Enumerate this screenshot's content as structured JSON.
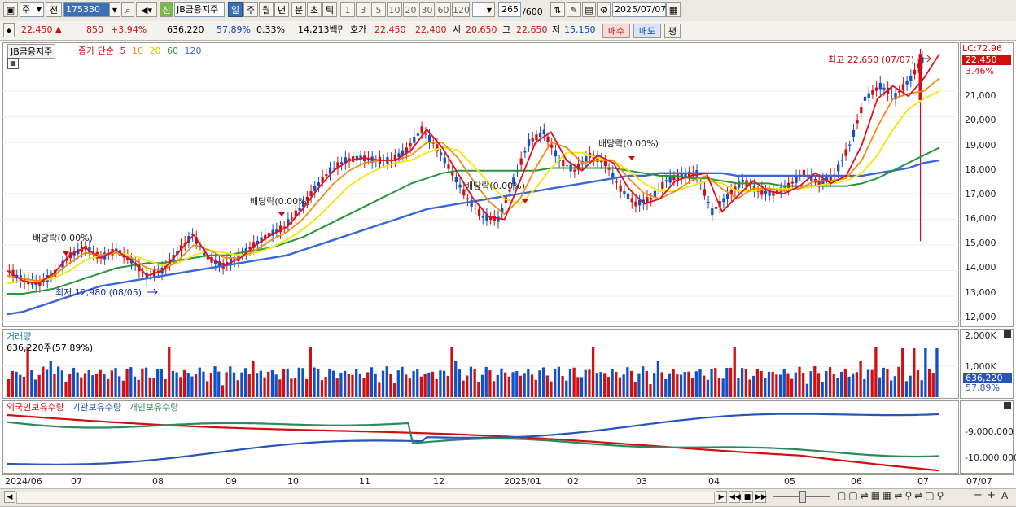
{
  "toolbar": {
    "type_select": "주",
    "prev_label": "전",
    "code": "175330",
    "credit_badge": "신",
    "stock_name": "JB금융지주",
    "period_tabs": [
      "일",
      "주",
      "월",
      "년",
      "분",
      "초",
      "틱"
    ],
    "active_period": "일",
    "interval_buttons": [
      "1",
      "3",
      "5",
      "10",
      "20",
      "30",
      "60",
      "120"
    ],
    "count_value": "265",
    "count_max": "/600",
    "date_value": "2025/07/07"
  },
  "quote": {
    "price": "22,450",
    "change": "850",
    "change_pct": "+3.94%",
    "volume": "636,220",
    "volume_ratio": "57.89%",
    "turnover": "0.33%",
    "amount": "14,213백만",
    "bid_label": "호가",
    "bid1": "22,450",
    "bid2": "22,400",
    "open_label": "시",
    "open": "20,650",
    "high_label": "고",
    "high": "22,650",
    "low_label": "저",
    "low": "15,150",
    "buy_label": "매수",
    "sell_label": "매도",
    "extra_label": "평"
  },
  "price_panel": {
    "name_box": "JB금융지주",
    "legend_text": "종가 단순",
    "ma_labels": [
      "5",
      "10",
      "20",
      "60",
      "120"
    ],
    "lc_label": "LC:72.96",
    "last_price": "22,450",
    "last_pct": "3.46%",
    "high_annotation": "최고 22,650 (07/07)",
    "low_annotation": "최저 12,980 (08/05)",
    "dividend_labels": [
      "배당락(0.00%)",
      "배당락(0.00%)",
      "배당락(0.00%)",
      "배당락(0.00%)"
    ],
    "y_ticks": [
      "21,000",
      "20,000",
      "19,000",
      "18,000",
      "17,000",
      "16,000",
      "15,000",
      "14,000",
      "13,000",
      "12,000"
    ]
  },
  "volume_panel": {
    "title": "거래량",
    "value_text": "636,220주(57.89%)",
    "y_ticks": [
      "2,000K",
      "1,000K"
    ],
    "last_value": "636,220",
    "last_pct": "57.89%"
  },
  "holdings_panel": {
    "legends": [
      "외국인보유수량",
      "기관보유수량",
      "개인보유수량"
    ],
    "y_ticks": [
      "-9,000,000",
      "-10,000,000"
    ]
  },
  "x_axis": [
    "2024/06",
    "07",
    "08",
    "09",
    "10",
    "11",
    "12",
    "2025/01",
    "02",
    "03",
    "04",
    "05",
    "06",
    "07",
    "07/07"
  ],
  "colors": {
    "up": "#d01010",
    "down": "#1050c8",
    "ma5": "#e0101e",
    "ma10": "#f08a18",
    "ma20": "#f5e61c",
    "ma60": "#26963a",
    "ma120": "#3a66d8"
  },
  "chart_data": {
    "type": "line",
    "title": "JB금융지주",
    "ylim": [
      11800,
      22900
    ],
    "series": [
      {
        "name": "5",
        "values": [
          14000,
          13600,
          13500,
          13900,
          14600,
          14900,
          14500,
          14800,
          14400,
          13800,
          14000,
          14700,
          15400,
          14500,
          14200,
          14500,
          15000,
          15400,
          15700,
          16400,
          17200,
          17900,
          18300,
          18400,
          18300,
          18300,
          18700,
          19500,
          18800,
          17800,
          16800,
          16100,
          16000,
          17500,
          19000,
          19400,
          18300,
          17900,
          18500,
          18200,
          17200,
          16600,
          16800,
          17500,
          17700,
          17800,
          16300,
          16900,
          17500,
          17100,
          17000,
          17300,
          17800,
          17400,
          17700,
          18900,
          20700,
          21200,
          20800,
          21500,
          22450
        ]
      },
      {
        "name": "10",
        "values": [
          13800,
          13700,
          13600,
          13800,
          14300,
          14700,
          14600,
          14700,
          14500,
          14100,
          14000,
          14400,
          15000,
          14800,
          14500,
          14500,
          14800,
          15200,
          15500,
          16000,
          16700,
          17400,
          17900,
          18200,
          18300,
          18300,
          18500,
          19000,
          19000,
          18400,
          17500,
          16700,
          16200,
          16800,
          18000,
          19000,
          18800,
          18200,
          18300,
          18300,
          17600,
          17000,
          16800,
          17100,
          17500,
          17700,
          17200,
          16800,
          17200,
          17200,
          17100,
          17200,
          17500,
          17500,
          17600,
          18300,
          19600,
          20700,
          20900,
          21000,
          21500
        ]
      },
      {
        "name": "20",
        "values": [
          13500,
          13600,
          13600,
          13700,
          14000,
          14400,
          14600,
          14700,
          14600,
          14400,
          14200,
          14300,
          14600,
          14800,
          14700,
          14600,
          14700,
          14900,
          15200,
          15600,
          16100,
          16700,
          17300,
          17700,
          18000,
          18200,
          18300,
          18600,
          18800,
          18700,
          18100,
          17400,
          16800,
          16600,
          17200,
          18000,
          18600,
          18600,
          18400,
          18300,
          17900,
          17400,
          17100,
          17100,
          17300,
          17500,
          17400,
          17100,
          17100,
          17200,
          17200,
          17200,
          17300,
          17400,
          17500,
          17800,
          18500,
          19500,
          20300,
          20700,
          21000
        ]
      },
      {
        "name": "60",
        "values": [
          13100,
          13100,
          13200,
          13300,
          13500,
          13700,
          13900,
          14100,
          14200,
          14300,
          14300,
          14400,
          14500,
          14600,
          14600,
          14700,
          14800,
          14900,
          15100,
          15300,
          15600,
          15900,
          16200,
          16500,
          16800,
          17100,
          17400,
          17600,
          17800,
          17900,
          17900,
          17900,
          17900,
          17900,
          17900,
          18000,
          18000,
          18000,
          18000,
          18000,
          17900,
          17800,
          17700,
          17700,
          17600,
          17600,
          17500,
          17400,
          17400,
          17400,
          17300,
          17300,
          17300,
          17300,
          17300,
          17400,
          17600,
          17900,
          18200,
          18500,
          18800
        ]
      },
      {
        "name": "120",
        "values": [
          12300,
          12400,
          12600,
          12800,
          13000,
          13200,
          13400,
          13500,
          13600,
          13700,
          13800,
          13900,
          14000,
          14100,
          14200,
          14300,
          14400,
          14500,
          14600,
          14800,
          15000,
          15200,
          15400,
          15600,
          15800,
          16000,
          16200,
          16400,
          16500,
          16600,
          16700,
          16800,
          16900,
          17000,
          17100,
          17200,
          17300,
          17400,
          17500,
          17600,
          17700,
          17700,
          17800,
          17800,
          17800,
          17800,
          17800,
          17700,
          17700,
          17700,
          17700,
          17700,
          17700,
          17700,
          17700,
          17700,
          17800,
          17900,
          18000,
          18200,
          18300
        ]
      }
    ]
  }
}
